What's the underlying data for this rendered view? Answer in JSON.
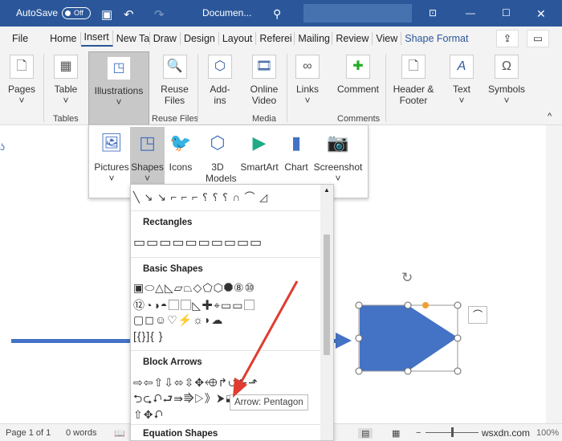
{
  "titlebar": {
    "autosave": "AutoSave",
    "toggle": "Off",
    "doc": "Documen...",
    "icons": [
      "save-icon",
      "undo-icon",
      "redo-icon",
      "search-icon",
      "ribbon-display-icon",
      "minimize-icon",
      "maximize-icon",
      "close-icon"
    ]
  },
  "tabs": [
    "File",
    "Home",
    "Insert",
    "New Ta",
    "Draw",
    "Design",
    "Layout",
    "Referei",
    "Mailing",
    "Review",
    "View",
    "Shape Format"
  ],
  "ribbon": {
    "pages": "Pages",
    "table": "Table",
    "illustrations": "Illustrations",
    "reuse": "Reuse Files",
    "addins": "Add-ins",
    "online_video": "Online Video",
    "links": "Links",
    "comment": "Comment",
    "header_footer": "Header & Footer",
    "text": "Text",
    "symbols": "Symbols",
    "groups": {
      "tables": "Tables",
      "reuse": "Reuse Files",
      "media": "Media",
      "comments": "Comments"
    }
  },
  "illustrations_menu": {
    "pictures": "Pictures",
    "shapes": "Shapes",
    "icons": "Icons",
    "models": "3D Models",
    "smartart": "SmartArt",
    "chart": "Chart",
    "screenshot": "Screenshot"
  },
  "gallery": {
    "sections": [
      "Rectangles",
      "Basic Shapes",
      "Block Arrows",
      "Equation Shapes"
    ],
    "lines": "╲ ↘ ↘ ⌐ ⌐ ⌐ ⸮ ⸮ ⸮ ∩ ⌒ ◿",
    "rects": "▭▭▭▭▭▭▭▭▭▭",
    "basic": [
      "▣⬭△◺▱⏢◇⬠⬡⯃⑧⑩",
      "⑫◔◑◓▢▢◺✚⌖▭▭▢",
      "▢◻☺♡⚡☼◗☁",
      "[{}]{ }"
    ],
    "arrows": [
      "⇨⇦⇧⇩⬄⇳✥⬲↱⮍⬑⬏",
      "⮌⮎⮏⮐⇛⭆▷》⮞⬓◧⬒",
      "⇧✥⮏"
    ],
    "tooltip": "Arrow: Pentagon"
  },
  "status": {
    "page": "Page 1 of 1",
    "words": "0 words",
    "zoom": "100%"
  },
  "watermark": "wsxdn.com",
  "colors": {
    "title": "#2b579a",
    "shape": "#4472c4",
    "arrow": "#e03c31"
  }
}
